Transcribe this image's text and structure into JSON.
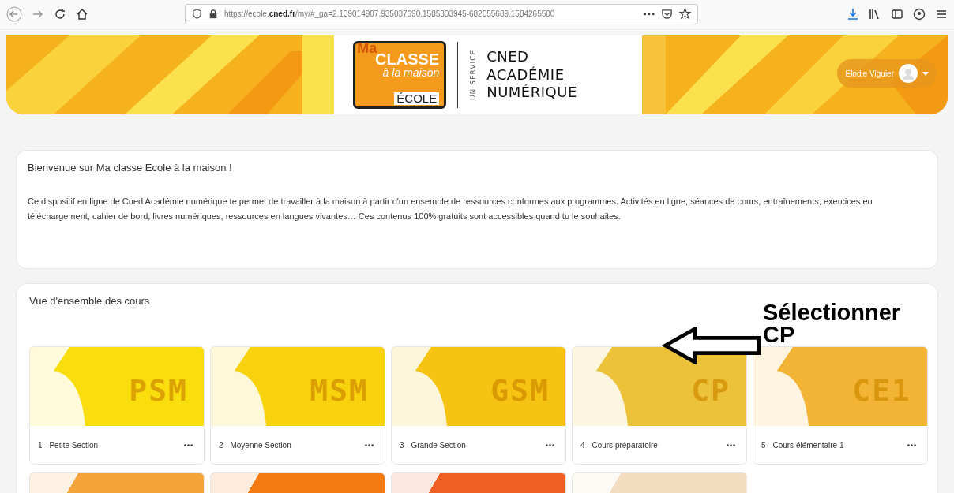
{
  "browser": {
    "url_host": "https://ecole.",
    "url_domain": "cned.fr",
    "url_path": "/my/#_ga=2.139014907.935037690.1585303945-682055689.1584265500"
  },
  "banner": {
    "logo_top": "Ma",
    "logo_main": "CLASSE",
    "logo_sub": "à la maison",
    "logo_bottom": "ÉCOLE",
    "service": "UN SERVICE",
    "brand_lines": [
      "CNED",
      "ACADÉMIE",
      "NUMÉRIQUE"
    ],
    "user_name": "Elodie Viguier"
  },
  "welcome": {
    "title": "Bienvenue sur Ma classe Ecole à la maison !",
    "text": "Ce dispositif en ligne de Cned Académie numérique te permet de travailler à la maison à partir d'un ensemble de ressources conformes aux programmes. Activités en ligne, séances de cours, entraînements, exercices en téléchargement, cahier de bord, livres numériques, ressources en langues vivantes… Ces contenus 100% gratuits sont accessibles quand tu le souhaites."
  },
  "courses": {
    "title": "Vue d'ensemble des cours",
    "items": [
      {
        "code": "PSM",
        "label": "1 - Petite Section",
        "color": "#f9dd0c"
      },
      {
        "code": "MSM",
        "label": "2 - Moyenne Section",
        "color": "#f8d20c"
      },
      {
        "code": "GSM",
        "label": "3 - Grande Section",
        "color": "#f7c312"
      },
      {
        "code": "CP",
        "label": "4 - Cours préparatoire",
        "color": "#ebc23a"
      },
      {
        "code": "CE1",
        "label": "5 - Cours élémentaire 1",
        "color": "#f3b334"
      }
    ],
    "partial_items": [
      {
        "color": "#f3a53a"
      },
      {
        "color": "#f57a12"
      },
      {
        "color": "#ef5f22"
      },
      {
        "color": "#f4dcc0"
      }
    ]
  },
  "annotation": {
    "lines": [
      "Sélectionner",
      "CP"
    ]
  }
}
